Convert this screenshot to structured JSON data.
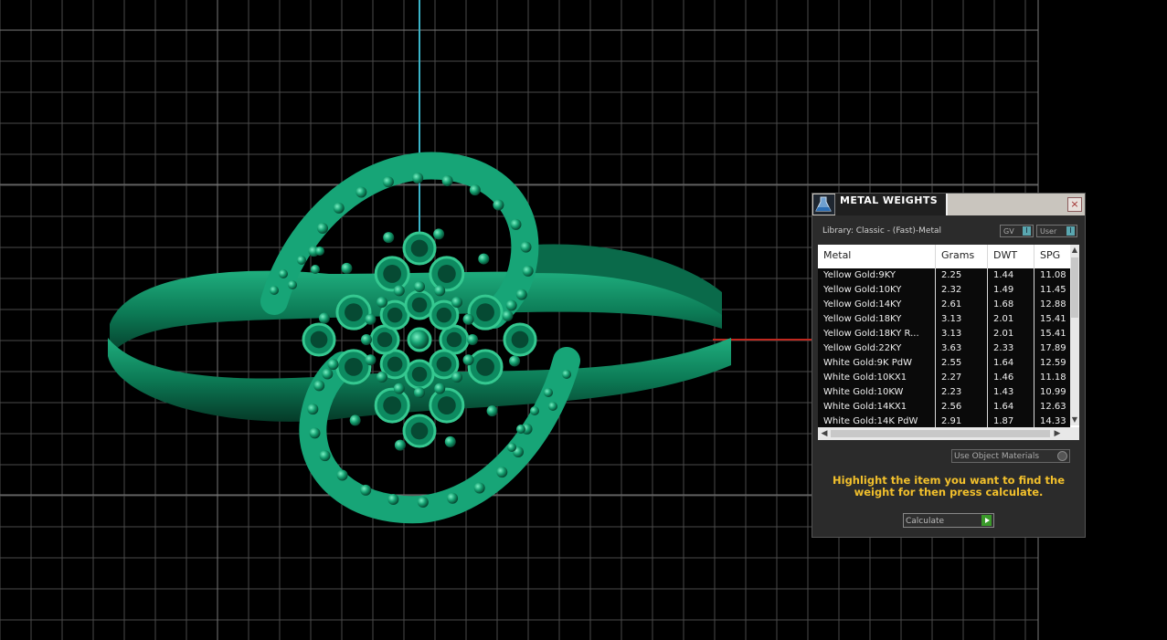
{
  "panel": {
    "title": "METAL WEIGHTS",
    "close_glyph": "×",
    "library_label": "Library: Classic - (Fast)-Metal",
    "gv_label": "GV",
    "user_label": "User",
    "use_object_materials_label": "Use Object Materials",
    "hint": "Highlight the item you want to find the weight for then press calculate.",
    "calculate_label": "Calculate"
  },
  "table": {
    "columns": [
      "Metal",
      "Grams",
      "DWT",
      "SPG"
    ],
    "rows": [
      [
        "Yellow Gold:9KY",
        "2.25",
        "1.44",
        "11.08"
      ],
      [
        "Yellow Gold:10KY",
        "2.32",
        "1.49",
        "11.45"
      ],
      [
        "Yellow Gold:14KY",
        "2.61",
        "1.68",
        "12.88"
      ],
      [
        "Yellow Gold:18KY",
        "3.13",
        "2.01",
        "15.41"
      ],
      [
        "Yellow Gold:18KY R...",
        "3.13",
        "2.01",
        "15.41"
      ],
      [
        "Yellow Gold:22KY",
        "3.63",
        "2.33",
        "17.89"
      ],
      [
        "White Gold:9K PdW",
        "2.55",
        "1.64",
        "12.59"
      ],
      [
        "White Gold:10KX1",
        "2.27",
        "1.46",
        "11.18"
      ],
      [
        "White Gold:10KW",
        "2.23",
        "1.43",
        "10.99"
      ],
      [
        "White Gold:14KX1",
        "2.56",
        "1.64",
        "12.63"
      ],
      [
        "White Gold:14K PdW",
        "2.91",
        "1.87",
        "14.33"
      ]
    ]
  },
  "colors": {
    "ring": "#0f8a63",
    "ring_light": "#3fcf9c",
    "grid": "#4a4a4a",
    "axis_y": "#3bb4c8",
    "axis_x": "#c0281f",
    "hint": "#f2c02c"
  },
  "icons": {
    "logo": "flask-icon",
    "close": "close-icon",
    "calculate": "play-arrow-icon"
  }
}
